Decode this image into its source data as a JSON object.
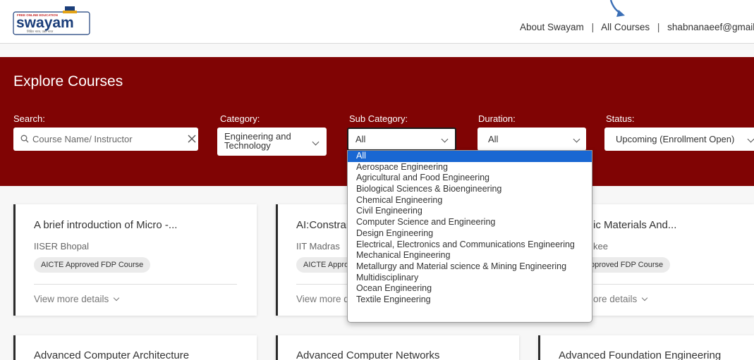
{
  "header": {
    "logo_top_text": "FREE ONLINE EDUCATION",
    "logo_text": "swayam",
    "logo_sub_text": "शिक्षित भारत, उन्नत भारत",
    "nav": [
      "About Swayam",
      "All Courses",
      "shabnanaeef@gmail.c"
    ],
    "nav_separator": "|"
  },
  "hero": {
    "title": "Explore Courses",
    "search": {
      "label": "Search:",
      "placeholder": "Course Name/ Instructor"
    },
    "category": {
      "label": "Category:",
      "value": "Engineering and Technology"
    },
    "sub_category": {
      "label": "Sub Category:",
      "value": "All"
    },
    "duration": {
      "label": "Duration:",
      "value": "All"
    },
    "status": {
      "label": "Status:",
      "value": "Upcoming (Enrollment Open)"
    }
  },
  "sub_category_options": [
    "All",
    "Aerospace Engineering",
    "Agricultural and Food Engineering",
    "Biological Sciences & Bioengineering",
    "Chemical Engineering",
    "Civil Engineering",
    "Computer Science and Engineering",
    "Design Engineering",
    "Electrical, Electronics and Communications Engineering",
    "Mechanical Engineering",
    "Metallurgy and Material science & Mining Engineering",
    "Multidisciplinary",
    "Ocean Engineering",
    "Textile Engineering"
  ],
  "cards": [
    {
      "title": "A brief introduction of Micro -...",
      "institute": "IISER Bhopal",
      "badge": "AICTE Approved FDP Course",
      "more": "View more details"
    },
    {
      "title": "AI:Constrai",
      "institute": "IIT Madras",
      "badge": "AICTE Appro",
      "more": "View more d"
    },
    {
      "title": "ic Materials And...",
      "institute": "kee",
      "badge": "pproved FDP Course",
      "more": "ore details"
    },
    {
      "title": "Advanced Computer Architecture"
    },
    {
      "title": "Advanced Computer Networks"
    },
    {
      "title": "Advanced Foundation Engineering"
    }
  ],
  "colors": {
    "hero_bg": "#800404",
    "selected_option": "#1967d2",
    "arrow": "#3b6fb6"
  }
}
